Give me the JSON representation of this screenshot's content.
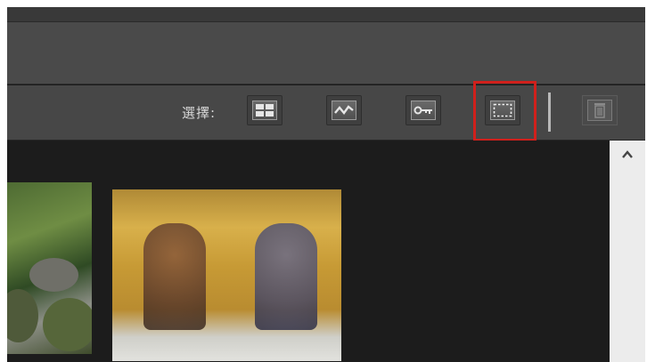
{
  "toolbar": {
    "select_label": "選擇:",
    "buttons": [
      {
        "name": "grid-view-button",
        "icon": "grid-icon"
      },
      {
        "name": "waveform-button",
        "icon": "waveform-icon"
      },
      {
        "name": "key-button",
        "icon": "key-icon"
      },
      {
        "name": "marquee-select-button",
        "icon": "dashed-rect-icon",
        "highlighted": true
      }
    ],
    "delete": {
      "icon": "trash-icon",
      "enabled": false
    }
  },
  "gallery": {
    "items": [
      {
        "name": "forest-waterfall-thumbnail"
      },
      {
        "name": "temple-statues-thumbnail"
      }
    ]
  },
  "colors": {
    "highlight": "#d0201c",
    "panel_dark": "#1c1c1c",
    "toolbar": "#474747"
  }
}
